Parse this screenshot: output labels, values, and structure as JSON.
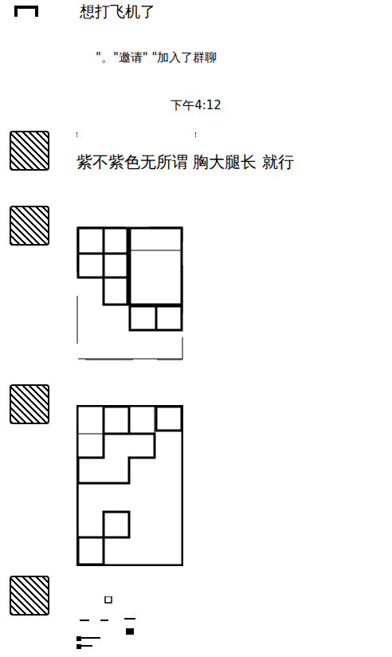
{
  "top_message": {
    "text": "想打飞机了"
  },
  "system_message": {
    "text": "\"。\"邀请\"      \"加入了群聊"
  },
  "timestamp": "下午4:12",
  "messages": [
    {
      "kind": "text",
      "text": "紫不紫色无所谓 胸大腿长 就行"
    },
    {
      "kind": "image",
      "figure": "a"
    },
    {
      "kind": "image",
      "figure": "b"
    },
    {
      "kind": "image",
      "figure": "c"
    }
  ]
}
